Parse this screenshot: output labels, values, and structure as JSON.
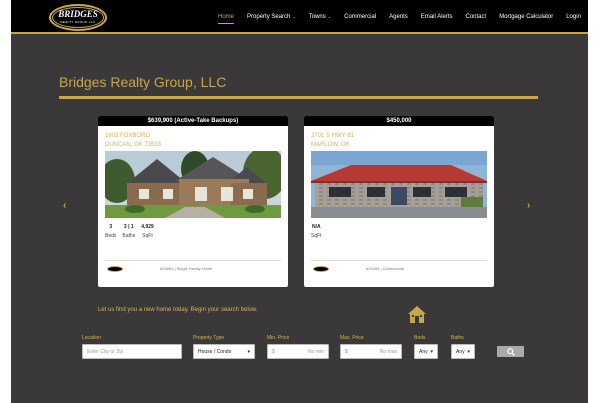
{
  "logo": {
    "line1": "BRIDGES",
    "line2": "REALTY GROUP, LLC"
  },
  "nav": {
    "home": "Home",
    "property_search": "Property Search",
    "towns": "Towns",
    "commercial": "Commercial",
    "agents": "Agents",
    "email_alerts": "Email Alerts",
    "contact": "Contact",
    "mortgage": "Mortgage Calculator",
    "login": "Login",
    "caret": "⌄"
  },
  "page_title": "Bridges Realty Group, LLC",
  "carousel": {
    "prev": "‹",
    "next": "›"
  },
  "listings": [
    {
      "price": "$639,900 (Active-Take Backups)",
      "street": "1602 FOXBORO",
      "city": "DUNCAN, OK 73533",
      "beds": "3",
      "beds_label": "Beds",
      "baths": "3 | 1",
      "baths_label": "Baths",
      "sqft": "4,929",
      "sqft_label": "SqFt",
      "meta": "#25063 | Single Family Home"
    },
    {
      "price": "$450,000",
      "street": "2701 S HWY 81",
      "city": "MARLOW, OK",
      "sqft": "N/A",
      "sqft_label": "SqFt",
      "meta": "#25495 | Commercial"
    }
  ],
  "search": {
    "cta": "Let us find you a new home today. Begin your search below.",
    "location_label": "Location",
    "location_placeholder": "Enter City or Zip",
    "type_label": "Property Type",
    "type_value": "House / Condo",
    "minprice_label": "Min. Price",
    "minprice_placeholder": "No min",
    "maxprice_label": "Max. Price",
    "maxprice_placeholder": "No max",
    "currency": "$",
    "beds_label": "Beds",
    "beds_value": "Any",
    "baths_label": "Baths",
    "baths_value": "Any",
    "caret": "▾"
  },
  "colors": {
    "gold": "#c9a64a",
    "background": "#3a3839",
    "topbar": "#000000"
  }
}
